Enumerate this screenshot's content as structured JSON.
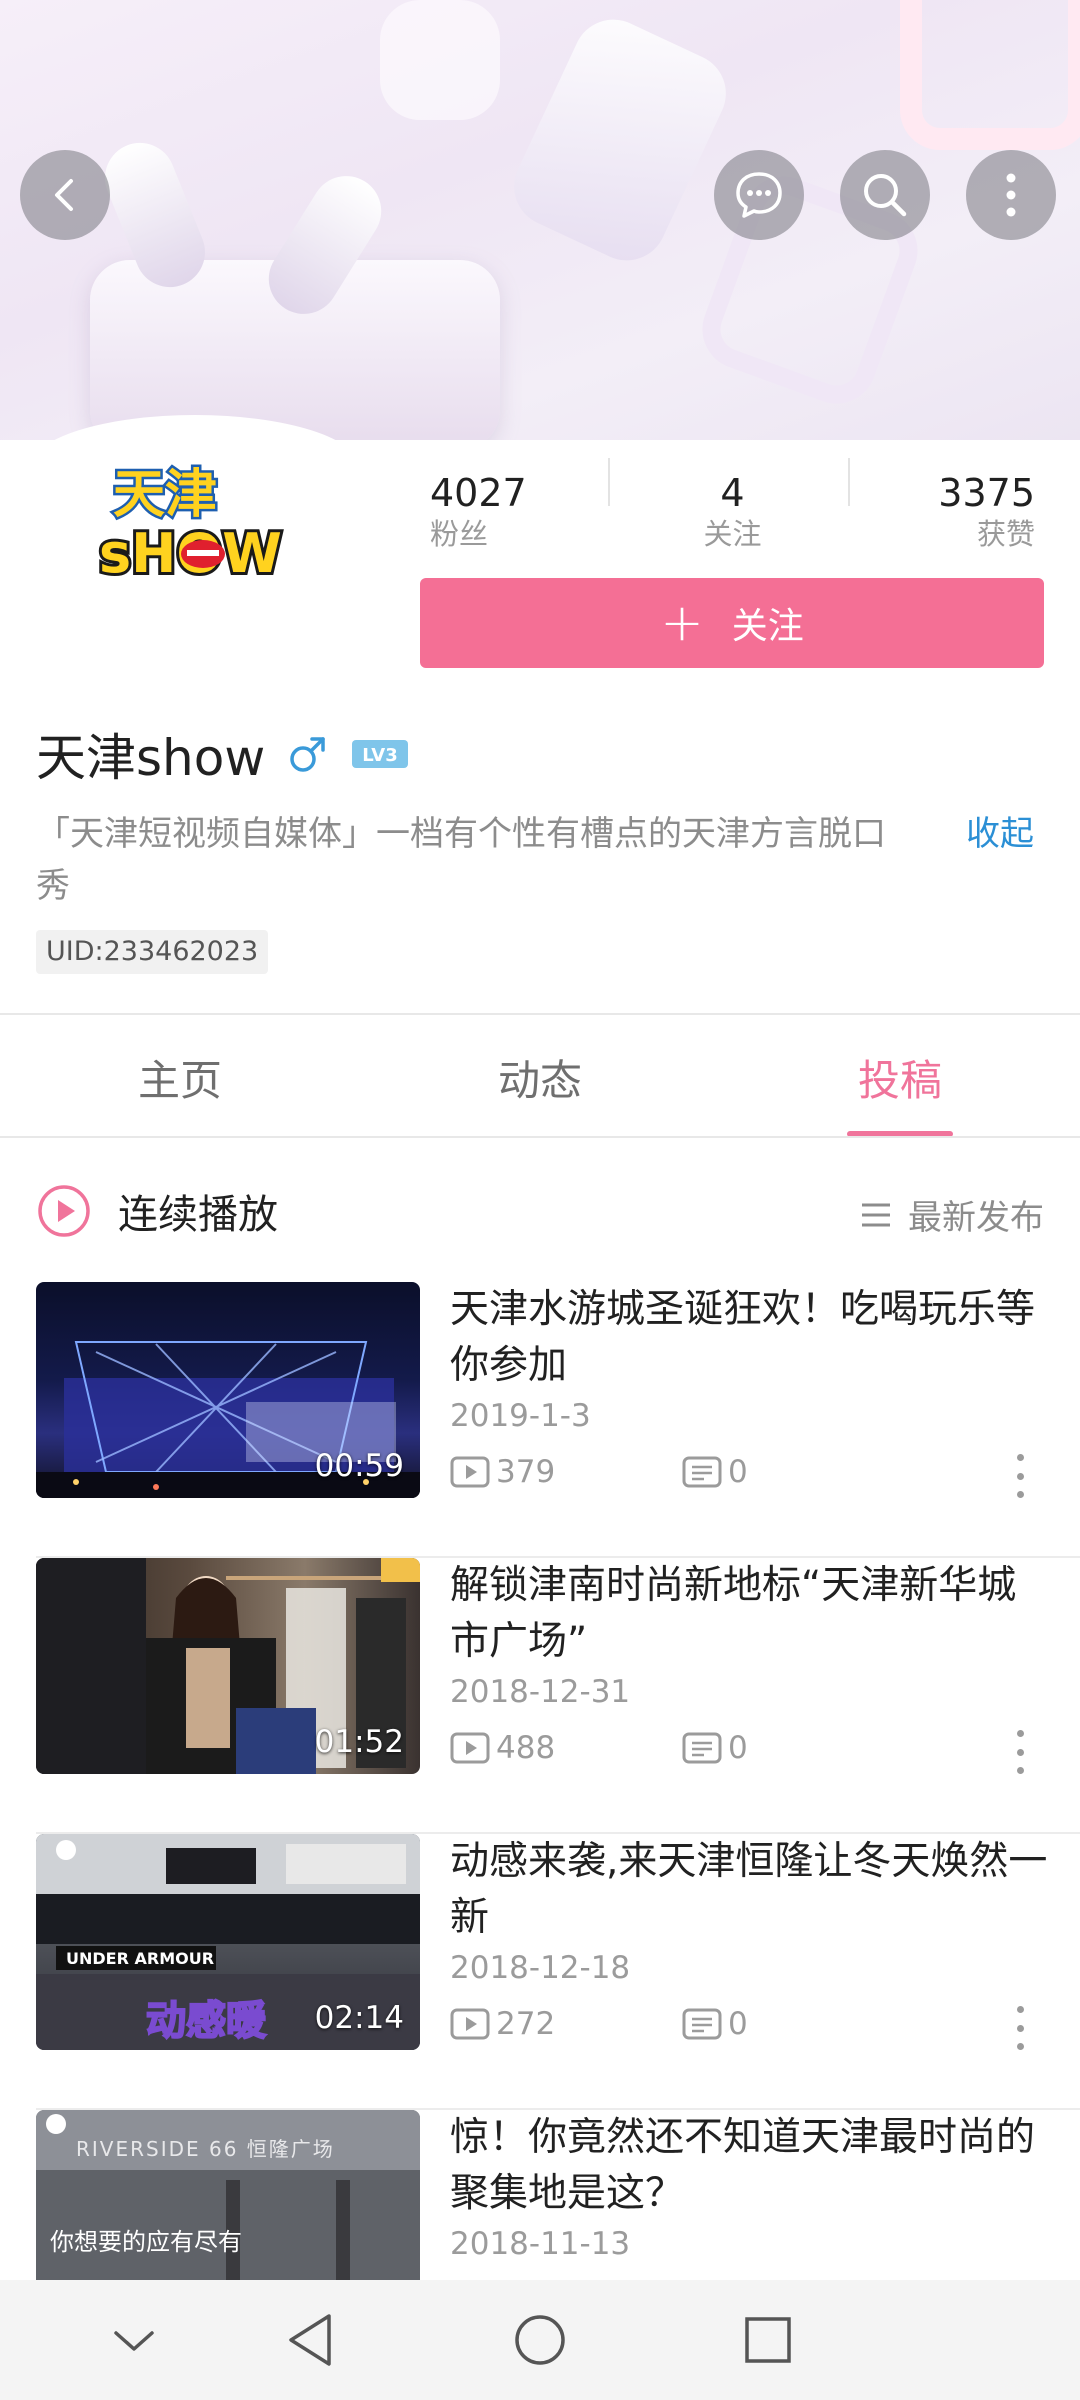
{
  "header": {
    "back_icon": "back-arrow-icon",
    "chat_icon": "message-icon",
    "search_icon": "search-icon",
    "more_icon": "more-vertical-icon"
  },
  "profile": {
    "avatar_text_top": "天津",
    "avatar_text_bottom": "sHOW",
    "stats": [
      {
        "value": "4027",
        "label": "粉丝"
      },
      {
        "value": "4",
        "label": "关注"
      },
      {
        "value": "3375",
        "label": "获赞"
      }
    ],
    "follow_label": "关注",
    "name": "天津show",
    "gender_icon": "male-icon",
    "level": "LV3",
    "bio": "「天津短视频自媒体」一档有个性有槽点的天津方言脱口秀",
    "collapse_label": "收起",
    "uid": "UID:233462023"
  },
  "tabs": [
    {
      "label": "主页",
      "active": false
    },
    {
      "label": "动态",
      "active": false
    },
    {
      "label": "投稿",
      "active": true
    }
  ],
  "list_header": {
    "play_all_label": "连续播放",
    "sort_label": "最新发布"
  },
  "videos": [
    {
      "title": "天津水游城圣诞狂欢！吃喝玩乐等你参加",
      "date": "2019-1-3",
      "duration": "00:59",
      "plays": "379",
      "comments": "0"
    },
    {
      "title": "解锁津南时尚新地标“天津新华城市广场”",
      "date": "2018-12-31",
      "duration": "01:52",
      "plays": "488",
      "comments": "0"
    },
    {
      "title": "动感来袭,来天津恒隆让冬天焕然一新",
      "date": "2018-12-18",
      "duration": "02:14",
      "plays": "272",
      "comments": "0"
    },
    {
      "title": "惊！你竟然还不知道天津最时尚的聚集地是这？",
      "date": "2018-11-13",
      "duration": "",
      "plays": "",
      "comments": ""
    }
  ],
  "thumb_texts": {
    "v3_brand": "UNDER ARMOUR",
    "v3_overlay": "动感暖",
    "v4_sign": "RIVERSIDE 66  恒隆广场",
    "v4_caption": "你想要的应有尽有"
  },
  "colors": {
    "accent_pink": "#f46f95",
    "link_blue": "#2b8fd5",
    "gender_blue": "#3a9ad9",
    "level_badge": "#7fc5ea"
  },
  "navbar": {
    "icons": [
      "collapse-chevron-icon",
      "back-triangle-icon",
      "home-circle-icon",
      "recents-square-icon"
    ]
  }
}
